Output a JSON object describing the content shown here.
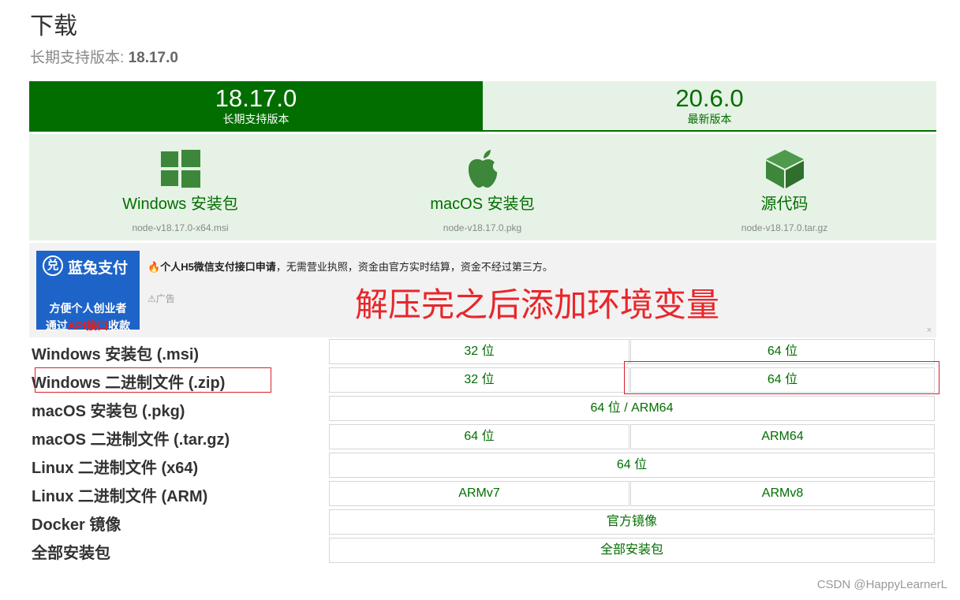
{
  "page": {
    "title": "下载",
    "subtitle_label": "长期支持版本: ",
    "subtitle_version": "18.17.0"
  },
  "tabs": [
    {
      "version": "18.17.0",
      "label": "长期支持版本",
      "active": true
    },
    {
      "version": "20.6.0",
      "label": "最新版本",
      "active": false
    }
  ],
  "downloads": [
    {
      "icon": "windows-icon",
      "label": "Windows 安装包",
      "file": "node-v18.17.0-x64.msi"
    },
    {
      "icon": "apple-icon",
      "label": "macOS 安装包",
      "file": "node-v18.17.0.pkg"
    },
    {
      "icon": "box-icon",
      "label": "源代码",
      "file": "node-v18.17.0.tar.gz"
    }
  ],
  "ad": {
    "brand": "蓝兔支付",
    "logo_glyph": "兑",
    "logo_line1": "方便个人创业者",
    "logo_line2_a": "通过",
    "logo_line2_red": "API接口",
    "logo_line2_b": "收款",
    "text_bold": "个人H5微信支付接口申请",
    "text_rest": "，无需营业执照，资金由官方实时结算，资金不经过第三方。",
    "tag": "广告",
    "close": "×"
  },
  "annotation": "解压完之后添加环境变量",
  "table": {
    "rows": [
      {
        "label": "Windows 安装包 (.msi)",
        "buttons": [
          "32 位",
          "64 位"
        ]
      },
      {
        "label": "Windows 二进制文件 (.zip)",
        "buttons": [
          "32 位",
          "64 位"
        ]
      },
      {
        "label": "macOS 安装包 (.pkg)",
        "buttons": [
          "64 位 / ARM64"
        ]
      },
      {
        "label": "macOS 二进制文件 (.tar.gz)",
        "buttons": [
          "64 位",
          "ARM64"
        ]
      },
      {
        "label": "Linux 二进制文件 (x64)",
        "buttons": [
          "64 位"
        ]
      },
      {
        "label": "Linux 二进制文件 (ARM)",
        "buttons": [
          "ARMv7",
          "ARMv8"
        ]
      },
      {
        "label": "Docker 镜像",
        "buttons": [
          "官方镜像"
        ]
      },
      {
        "label": "全部安装包",
        "buttons": [
          "全部安装包"
        ]
      }
    ]
  },
  "watermark": "CSDN @HappyLearnerL",
  "colors": {
    "brand_green": "#026e00",
    "light_green": "#e6f2e5",
    "highlight_red": "#d9202a"
  }
}
